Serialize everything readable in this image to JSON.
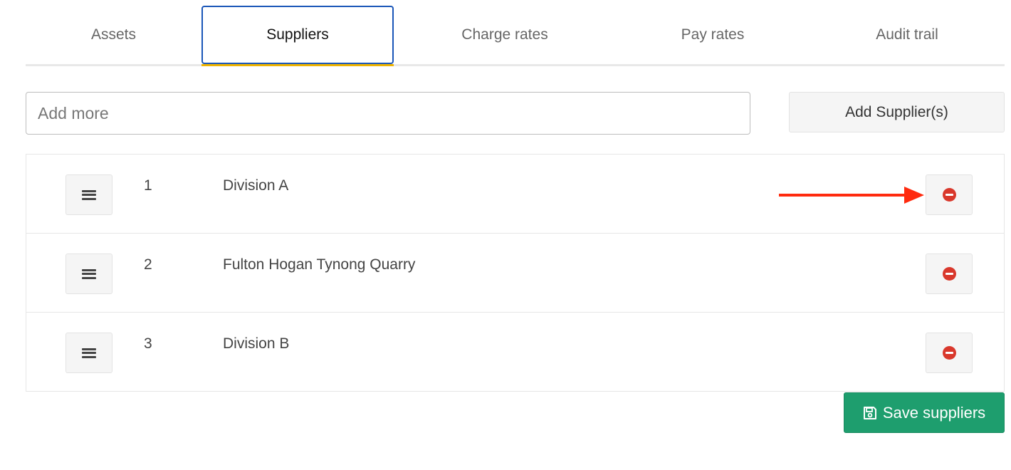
{
  "tabs": [
    {
      "label": "Assets",
      "active": false
    },
    {
      "label": "Suppliers",
      "active": true
    },
    {
      "label": "Charge rates",
      "active": false
    },
    {
      "label": "Pay rates",
      "active": false
    },
    {
      "label": "Audit trail",
      "active": false
    }
  ],
  "add_supplier": {
    "placeholder": "Add more",
    "value": "",
    "button_label": "Add Supplier(s)"
  },
  "suppliers": [
    {
      "index": "1",
      "name": "Division A"
    },
    {
      "index": "2",
      "name": "Fulton Hogan Tynong Quarry"
    },
    {
      "index": "3",
      "name": "Division B"
    }
  ],
  "icons": {
    "drag": "bars-icon",
    "remove": "minus-circle-icon",
    "save": "floppy-disk-icon",
    "annotation": "red-arrow"
  },
  "save_button": {
    "label": "Save suppliers"
  },
  "colors": {
    "active_tab_border": "#1a56b8",
    "active_tab_underline": "#f0b400",
    "remove_icon": "#d9382c",
    "save_button": "#1e9e6e",
    "annotation_arrow": "#ff2a0e"
  }
}
